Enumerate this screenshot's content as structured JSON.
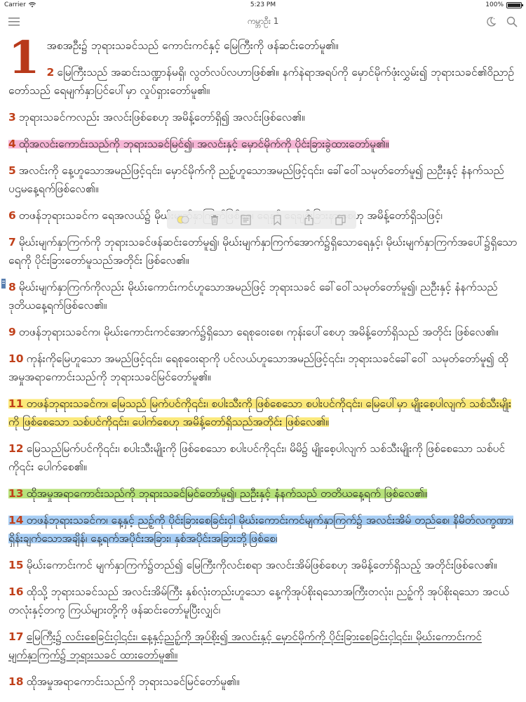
{
  "status": {
    "carrier": "Carrier",
    "time": "5:23 PM",
    "battery": "100%"
  },
  "nav": {
    "title": "ကမ္ဘာဦး 1"
  },
  "chapter": "1",
  "verses": [
    {
      "num": "",
      "text": "အစအဦး၌ ဘုရားသခင်သည် ကောင်းကင်နှင့် မြေကြီးကို ဖန်ဆင်းတော်မူ၏။",
      "hl": ""
    },
    {
      "num": "2",
      "text": "မြေကြီးသည် အဆင်းသဏ္ဍာန်မရှိ၊ လွတ်လပ်လဟာဖြစ်၏။ နက်နဲရာအရပ်ကို မှောင်မိုက်ဖုံးလွှမ်း၍ ဘုရားသခင်၏ဝိညာဉ်တော်သည် ရေမျက်နှာပြင်ပေါ်မှာ လှုပ်ရှားတော်မူ၏။",
      "hl": ""
    },
    {
      "num": "3",
      "text": "ဘုရားသခင်ကလည်း အလင်းဖြစ်စေဟု အမိန့်တော်ရှိ၍ အလင်းဖြစ်လေ၏။",
      "hl": ""
    },
    {
      "num": "4",
      "text": "ထိုအလင်းကောင်းသည်ကို ဘုရားသခင်မြင်၍၊ အလင်းနှင့် မှောင်မိုက်ကို ပိုင်းခြားခွဲထားတော်မူ၏။",
      "hl": "pink"
    },
    {
      "num": "5",
      "text": "အလင်းကို နေ့ဟူသောအမည်ဖြင့်၎င်း၊ မှောင်မိုက်ကို ညဉ့်ဟူသောအမည်ဖြင့်၎င်း၊ ခေါ်ဝေါ်သမုတ်တော်မူ၍ ညဦးနှင့် နံနက်သည် ပဌမနေ့ရက်ဖြစ်လေ၏။",
      "hl": ""
    },
    {
      "num": "6",
      "text": "တဖန်ဘုရားသခင်က ရေအလယ်၌ မိုဃ်းမျက်နှာကြက်ဖြစ်စေ၊ ရေနှင့် ရေချင်းခြားနားစေဟု အမိန့်တော်ရှိသဖြင့်၊",
      "hl": ""
    },
    {
      "num": "7",
      "text": "မိုဃ်းမျက်နှာကြက်ကို ဘုရားသခင်ဖန်ဆင်းတော်မူ၍၊ မိုဃ်းမျက်နှာကြက်အောက်၌ရှိသောရေနှင့်၊ မိုဃ်းမျက်နှာကြက်အပေါ်၌ရှိသောရေကို ပိုင်းခြားတော်မူသည်အတိုင်း ဖြစ်လေ၏။",
      "hl": ""
    },
    {
      "num": "8",
      "text": "မိုဃ်းမျက်နှာကြက်ကိုလည်း မိုဃ်းကောင်းကင်ဟူသောအမည်ဖြင့် ဘုရားသခင် ခေါ်ဝေါ်သမုတ်တော်မူ၍၊ ညဦးနှင့် နံနက်သည် ဒုတိယနေ့ရက်ဖြစ်လေ၏။",
      "hl": ""
    },
    {
      "num": "9",
      "text": "တဖန်ဘုရားသခင်က၊ မိုဃ်းကောင်းကင်အောက်၌ရှိသော ရေစုဝေးစေ၊ ကုန်းပေါ်စေဟု အမိန့်တော်ရှိသည် အတိုင်း ဖြစ်လေ၏။",
      "hl": ""
    },
    {
      "num": "10",
      "text": "ကုန်းကိုမြေဟူသော အမည်ဖြင့်၎င်း၊ ရေစုဝေးရာကို ပင်လယ်ဟူသောအမည်ဖြင့်၎င်း၊ ဘုရားသခင်ခေါ်ဝေါ် သမုတ်တော်မူ၍ ထိုအမှုအရာကောင်းသည်ကို ဘုရားသခင်မြင်တော်မူ၏။",
      "hl": ""
    },
    {
      "num": "11",
      "text": "တဖန်ဘုရားသခင်က၊ မြေသည် မြက်ပင်ကို၎င်း၊ စပါးသီးကို ဖြစ်စေသော စပါးပင်ကို၎င်း၊ မြေပေါ်မှာ မျိုးစေ့ပါလျက် သစ်သီးမျိုးကို ဖြစ်စေသော သစ်ပင်ကို၎င်း၊ ပေါက်စေဟု အမိန့်တော်ရှိသည်အတိုင်း ဖြစ်လေ၏။",
      "hl": "yellow"
    },
    {
      "num": "12",
      "text": "မြေသည်မြက်ပင်ကို၎င်း၊ စပါးသီးမျိုးကို ဖြစ်စေသော စပါးပင်ကို၎င်း၊ မိမိ၌ မျိုးစေ့ပါလျက် သစ်သီးမျိုးကို ဖြစ်စေသော သစ်ပင်ကို၎င်း ပေါက်စေ၏။",
      "hl": ""
    },
    {
      "num": "13",
      "text": "ထိုအမှုအရာကောင်းသည်ကို ဘုရားသခင်မြင်တော်မူ၍၊ ညဦးနှင့် နံနက်သည် တတိယနေ့ရက် ဖြစ်လေ၏။",
      "hl": "green"
    },
    {
      "num": "14",
      "text": "တဖန်ဘုရားသခင်က၊ နေ့နှင့် ညဉ့်ကို ပိုင်းခြားစေခြင်းငှါ မိုဃ်းကောင်းကင်မျက်နှာကြက်၌ အလင်းအိမ် တည်စေ၊ နိမိတ်လက္ခဏာ၊ ရှိန်းချက်သောအချိန်၊ နေ့ရက်အပိုင်းအခြား၊ နှစ်အပိုင်းအခြားဘို့ဖြစ်စေ၊",
      "hl": "blue"
    },
    {
      "num": "15",
      "text": "မိုဃ်းကောင်းကင် မျက်နှာကြက်၌တည်၍ မြေကြီးကိုလင်းစရာ အလင်းအိမ်ဖြစ်စေဟု အမိန့်တော်ရှိသည့် အတိုင်းဖြစ်လေ၏။",
      "hl": ""
    },
    {
      "num": "16",
      "text": "ထိုသို့ ဘုရားသခင်သည် အလင်းအိမ်ကြီး နှစ်လုံးတည်းဟူသော နေ့ကိုအုပ်စိုးရသောအကြီးတလုံး၊ ညဉ့်ကို အုပ်စိုးရသော အငယ်တလုံးနှင့်တကွ ကြယ်များတို့ကို ဖန်ဆင်းတော်မူပြီးလျှင်၊",
      "hl": ""
    },
    {
      "num": "17",
      "text": "မြေကြီး၌ လင်းစေခြင်းငှါ၎င်း၊ နေ့နှင့်ညဉ့်ကို အုပ်စိုး၍ အလင်းနှင့် မှောင်မိုက်ကို ပိုင်းခြားစေခြင်းငှါ၎င်း၊ မိုဃ်းကောင်းကင်မျက်နှာကြက်၌ ဘုရားသခင် ထားတော်မူ၏။",
      "hl": "underline"
    },
    {
      "num": "18",
      "text": "ထိုအမှုအရာကောင်းသည်ကို ဘုရားသခင်မြင်တော်မူ၏။",
      "hl": ""
    }
  ],
  "colors": {
    "verse_number": "#c0401a",
    "chapter_number": "#b8391a",
    "highlight_pink": "#f7b6d6",
    "highlight_yellow": "#fbe97a",
    "highlight_green": "#b7e27a",
    "highlight_blue": "#a6cdf4"
  },
  "icons": {
    "menu": "hamburger-icon",
    "night_mode": "moon-icon",
    "search": "search-icon",
    "toolbar": [
      "highlight-color-icon",
      "delete-icon",
      "note-icon",
      "bookmark-icon",
      "share-icon",
      "copy-icon"
    ]
  }
}
